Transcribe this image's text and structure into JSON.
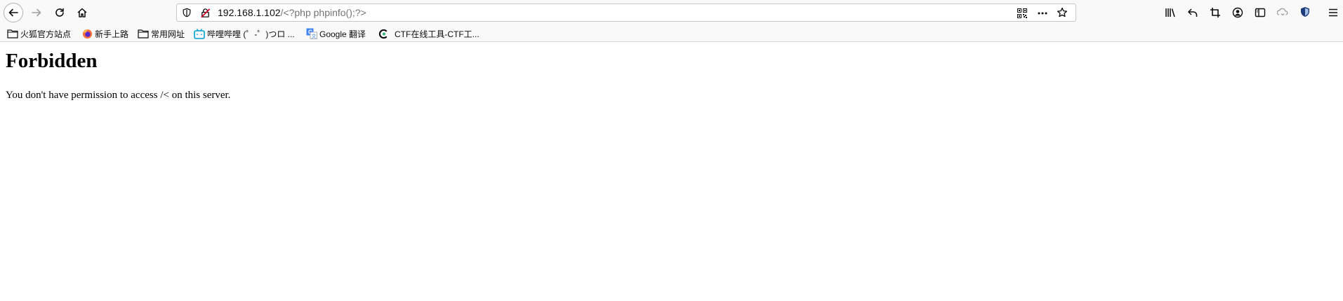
{
  "browser": {
    "url_host": "192.168.1.102",
    "url_path": "/<?php phpinfo();?>",
    "toolbar_icons": [
      "back-icon",
      "forward-icon",
      "reload-icon",
      "home-icon",
      "tracking-protection-icon",
      "insecure-lock-icon",
      "qr-code-icon",
      "more-icon",
      "bookmark-star-icon",
      "library-icon",
      "undo-icon",
      "screenshot-icon",
      "account-icon",
      "sidebar-icon",
      "sync-icon",
      "shield-extension-icon",
      "menu-icon"
    ]
  },
  "bookmarks": [
    {
      "label": "火狐官方站点",
      "icon": "folder-icon"
    },
    {
      "label": "新手上路",
      "icon": "firefox-icon"
    },
    {
      "label": "常用网址",
      "icon": "folder-icon"
    },
    {
      "label": "哔哩哔哩 (゜-゜)つロ ...",
      "icon": "bilibili-icon"
    },
    {
      "label": "Google 翻译",
      "icon": "google-translate-icon"
    },
    {
      "label": "CTF在线工具-CTF工...",
      "icon": "ctf-tools-icon"
    }
  ],
  "page": {
    "heading": "Forbidden",
    "message": "You don't have permission to access /< on this server."
  },
  "colors": {
    "toolbar_bg": "#f9f9fa",
    "insecure_red": "#d70022",
    "bilibili_blue": "#00a1d6",
    "firefox_orange": "#ff7139"
  }
}
